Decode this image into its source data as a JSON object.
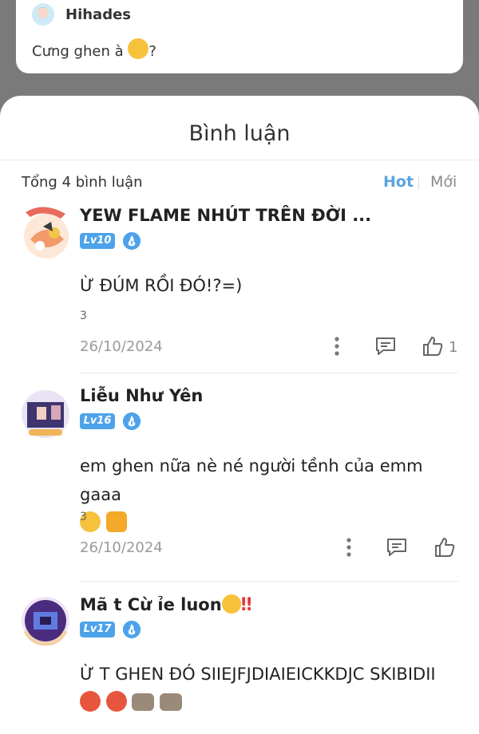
{
  "post": {
    "author": "Hihades",
    "text": "Cưng ghen à",
    "text_suffix": "?"
  },
  "sheet": {
    "title": "Bình luận",
    "total_label": "Tổng 4 bình luận",
    "tab_hot": "Hot",
    "tab_new": "Mới"
  },
  "comments": [
    {
      "name": "YEW FLAME NHÚT TRÊN ĐỜI ...",
      "level": "Lv10",
      "text": "Ừ ĐÚM RỒI ĐÓ!?=)",
      "count": "3",
      "date": "26/10/2024",
      "likes": "1"
    },
    {
      "name": "Liễu Như Yên",
      "level": "Lv16",
      "text": "em ghen nữa nè né người tềnh của emm gaaa",
      "count": "3",
      "date": "26/10/2024",
      "likes": ""
    },
    {
      "name": "Mã t Cừ ỉe luon",
      "level": "Lv17",
      "text": "Ừ T GHEN ĐÓ SIIEJFJDIAIEICKKDJC SKIBIDII",
      "count": "",
      "date": "",
      "likes": ""
    }
  ],
  "icons": {
    "more": "more-vertical-icon",
    "reply": "comment-icon",
    "like": "thumbs-up-icon",
    "badge": "flame-badge-icon"
  },
  "colors": {
    "accent": "#4da3ea",
    "tab_active": "#5aa3e0",
    "overlay": "#7a7a7a"
  }
}
